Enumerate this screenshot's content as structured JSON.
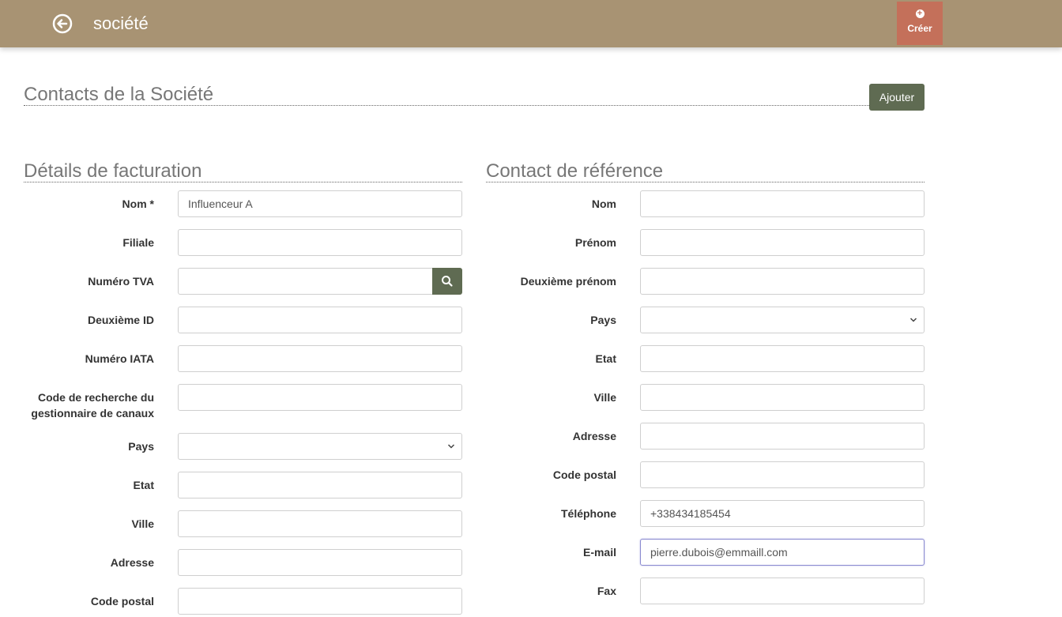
{
  "header": {
    "title": "société",
    "create_label": "Créer"
  },
  "contacts": {
    "title": "Contacts de la Société",
    "add_label": "Ajouter"
  },
  "billing": {
    "title": "Détails de facturation",
    "name_label": "Nom *",
    "name_value": "Influenceur A",
    "subsidiary_label": "Filiale",
    "vat_label": "Numéro TVA",
    "second_id_label": "Deuxième ID",
    "iata_label": "Numéro IATA",
    "channel_code_label_1": "Code de recherche du",
    "channel_code_label_2": "gestionnaire de canaux",
    "country_label": "Pays",
    "state_label": "Etat",
    "city_label": "Ville",
    "address_label": "Adresse",
    "postal_label": "Code postal"
  },
  "reference": {
    "title": "Contact de référence",
    "lastname_label": "Nom",
    "firstname_label": "Prénom",
    "middlename_label": "Deuxième prénom",
    "country_label": "Pays",
    "state_label": "Etat",
    "city_label": "Ville",
    "address_label": "Adresse",
    "postal_label": "Code postal",
    "phone_label": "Téléphone",
    "phone_value": "+338434185454",
    "email_label": "E-mail",
    "email_value": "pierre.dubois@emmaill.com",
    "fax_label": "Fax"
  },
  "icons": {
    "back": "back-arrow-circle-icon",
    "create": "plus-circle-icon",
    "search": "search-icon",
    "chevron": "chevron-down-icon"
  },
  "colors": {
    "header_bg": "#a89373",
    "create_bg": "#c4705a",
    "button_bg": "#5f6b52"
  }
}
